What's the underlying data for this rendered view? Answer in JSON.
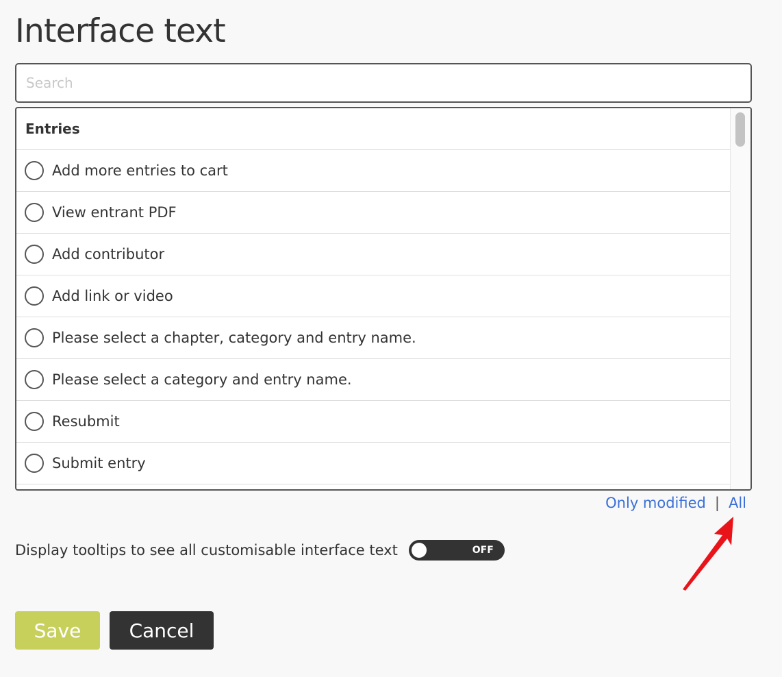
{
  "page": {
    "title": "Interface text"
  },
  "search": {
    "placeholder": "Search",
    "value": ""
  },
  "list": {
    "group_header": "Entries",
    "items": [
      {
        "label": "Add more entries to cart",
        "selected": false
      },
      {
        "label": "View entrant PDF",
        "selected": false
      },
      {
        "label": "Add contributor",
        "selected": false
      },
      {
        "label": "Add link or video",
        "selected": false
      },
      {
        "label": "Please select a chapter, category and entry name.",
        "selected": false
      },
      {
        "label": "Please select a category and entry name.",
        "selected": false
      },
      {
        "label": "Resubmit",
        "selected": false
      },
      {
        "label": "Submit entry",
        "selected": false
      }
    ]
  },
  "filters": {
    "only_modified": "Only modified",
    "separator": "|",
    "all": "All"
  },
  "tooltips": {
    "label": "Display tooltips to see all customisable interface text",
    "toggle_state": "OFF"
  },
  "actions": {
    "save": "Save",
    "cancel": "Cancel"
  },
  "colors": {
    "save_button": "#c8d05c",
    "cancel_button": "#333333",
    "link": "#3a6fd8",
    "annotation_arrow": "#e8141a"
  }
}
